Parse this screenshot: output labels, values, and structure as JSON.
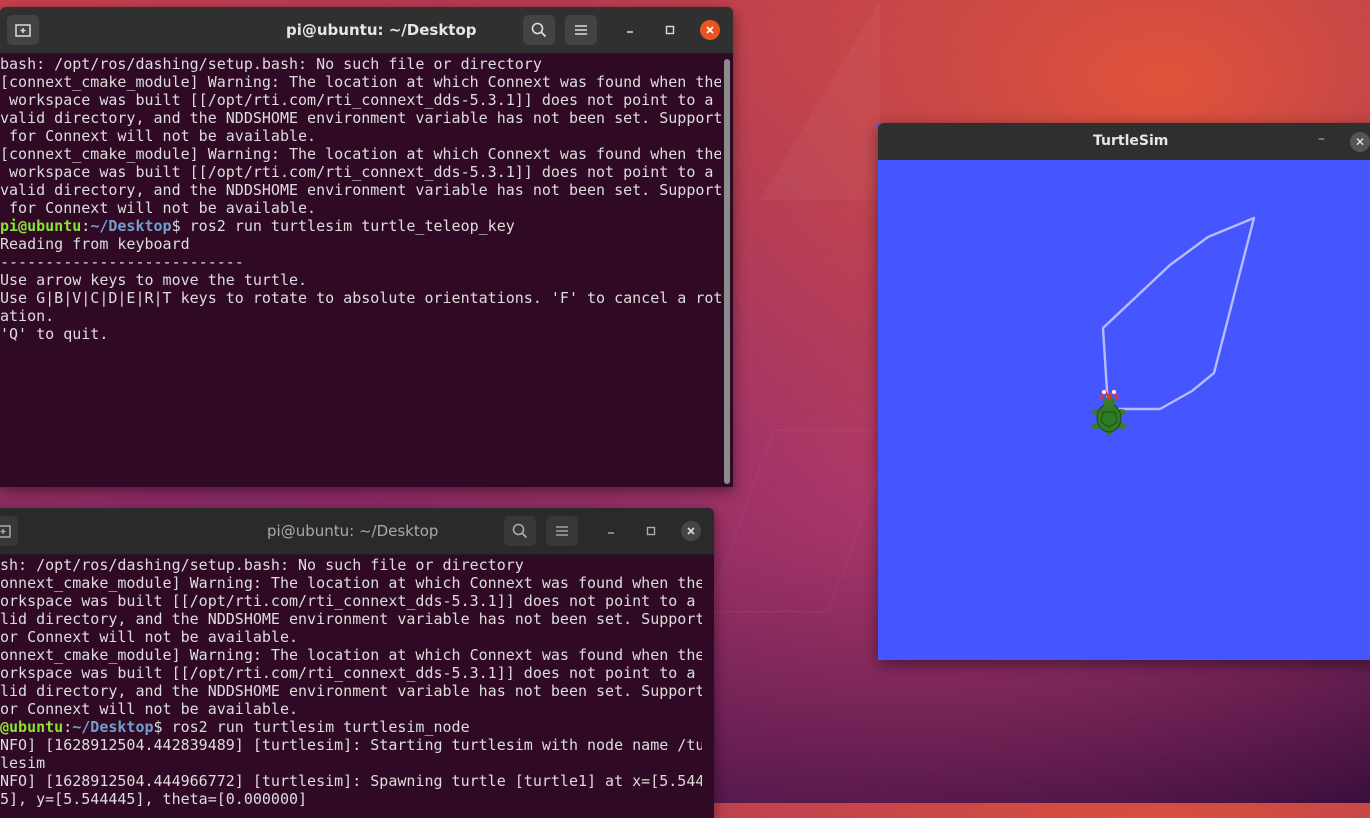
{
  "terminal_top": {
    "title": "pi@ubuntu: ~/Desktop",
    "lines": [
      {
        "text": "bash: /opt/ros/dashing/setup.bash: No such file or directory"
      },
      {
        "text": "[connext_cmake_module] Warning: The location at which Connext was found when the"
      },
      {
        "text": " workspace was built [[/opt/rti.com/rti_connext_dds-5.3.1]] does not point to a"
      },
      {
        "text": "valid directory, and the NDDSHOME environment variable has not been set. Support"
      },
      {
        "text": " for Connext will not be available."
      },
      {
        "text": "[connext_cmake_module] Warning: The location at which Connext was found when the"
      },
      {
        "text": " workspace was built [[/opt/rti.com/rti_connext_dds-5.3.1]] does not point to a"
      },
      {
        "text": "valid directory, and the NDDSHOME environment variable has not been set. Support"
      },
      {
        "text": " for Connext will not be available."
      },
      {
        "prompt_user": "pi@ubuntu",
        "prompt_sep": ":",
        "prompt_path": "~/Desktop",
        "prompt_end": "$ ",
        "text": "ros2 run turtlesim turtle_teleop_key"
      },
      {
        "text": "Reading from keyboard"
      },
      {
        "text": "---------------------------"
      },
      {
        "text": "Use arrow keys to move the turtle."
      },
      {
        "text": "Use G|B|V|C|D|E|R|T keys to rotate to absolute orientations. 'F' to cancel a rot"
      },
      {
        "text": "ation."
      },
      {
        "text": "'Q' to quit."
      }
    ]
  },
  "terminal_bottom": {
    "title": "pi@ubuntu: ~/Desktop",
    "lines": [
      {
        "text": "sh: /opt/ros/dashing/setup.bash: No such file or directory"
      },
      {
        "text": "onnext_cmake_module] Warning: The location at which Connext was found when the"
      },
      {
        "text": "orkspace was built [[/opt/rti.com/rti_connext_dds-5.3.1]] does not point to a"
      },
      {
        "text": "lid directory, and the NDDSHOME environment variable has not been set. Support"
      },
      {
        "text": "or Connext will not be available."
      },
      {
        "text": "onnext_cmake_module] Warning: The location at which Connext was found when the"
      },
      {
        "text": "orkspace was built [[/opt/rti.com/rti_connext_dds-5.3.1]] does not point to a"
      },
      {
        "text": "lid directory, and the NDDSHOME environment variable has not been set. Support"
      },
      {
        "text": "or Connext will not be available."
      },
      {
        "prompt_user": "@ubuntu",
        "prompt_sep": ":",
        "prompt_path": "~/Desktop",
        "prompt_end": "$ ",
        "text": "ros2 run turtlesim turtlesim_node"
      },
      {
        "text": "NFO] [1628912504.442839489] [turtlesim]: Starting turtlesim with node name /tu"
      },
      {
        "text": "lesim"
      },
      {
        "text": "NFO] [1628912504.444966772] [turtlesim]: Spawning turtle [turtle1] at x=[5.544"
      },
      {
        "text": "5], y=[5.544445], theta=[0.000000]"
      }
    ]
  },
  "turtlesim": {
    "title": "TurtleSim",
    "minimize_glyph": "–",
    "close_glyph": "✕"
  },
  "colors": {
    "terminal_bg": "#300a24",
    "prompt_user": "#8ae234",
    "prompt_path": "#729fcf",
    "sim_bg": "#4556ff",
    "accent_close": "#e95420"
  },
  "icons": {
    "new_tab": "new-tab-icon",
    "search": "search-icon",
    "menu": "hamburger-menu-icon",
    "minimize": "minimize-icon",
    "maximize": "maximize-icon",
    "close": "close-icon",
    "turtle": "turtle-icon"
  }
}
